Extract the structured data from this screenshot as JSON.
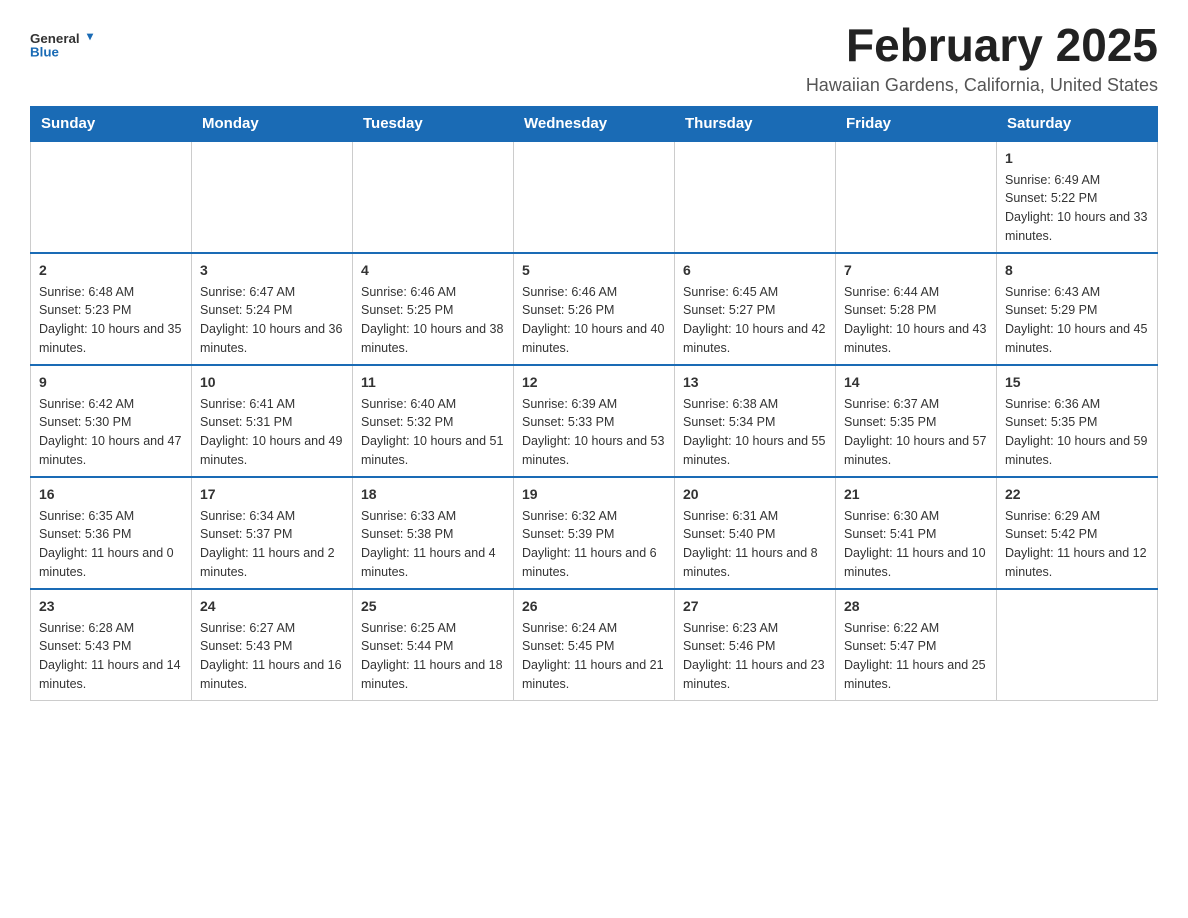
{
  "header": {
    "logo_text_general": "General",
    "logo_text_blue": "Blue",
    "month_title": "February 2025",
    "location": "Hawaiian Gardens, California, United States"
  },
  "days_of_week": [
    "Sunday",
    "Monday",
    "Tuesday",
    "Wednesday",
    "Thursday",
    "Friday",
    "Saturday"
  ],
  "weeks": [
    {
      "days": [
        {
          "num": "",
          "info": ""
        },
        {
          "num": "",
          "info": ""
        },
        {
          "num": "",
          "info": ""
        },
        {
          "num": "",
          "info": ""
        },
        {
          "num": "",
          "info": ""
        },
        {
          "num": "",
          "info": ""
        },
        {
          "num": "1",
          "info": "Sunrise: 6:49 AM\nSunset: 5:22 PM\nDaylight: 10 hours and 33 minutes."
        }
      ]
    },
    {
      "days": [
        {
          "num": "2",
          "info": "Sunrise: 6:48 AM\nSunset: 5:23 PM\nDaylight: 10 hours and 35 minutes."
        },
        {
          "num": "3",
          "info": "Sunrise: 6:47 AM\nSunset: 5:24 PM\nDaylight: 10 hours and 36 minutes."
        },
        {
          "num": "4",
          "info": "Sunrise: 6:46 AM\nSunset: 5:25 PM\nDaylight: 10 hours and 38 minutes."
        },
        {
          "num": "5",
          "info": "Sunrise: 6:46 AM\nSunset: 5:26 PM\nDaylight: 10 hours and 40 minutes."
        },
        {
          "num": "6",
          "info": "Sunrise: 6:45 AM\nSunset: 5:27 PM\nDaylight: 10 hours and 42 minutes."
        },
        {
          "num": "7",
          "info": "Sunrise: 6:44 AM\nSunset: 5:28 PM\nDaylight: 10 hours and 43 minutes."
        },
        {
          "num": "8",
          "info": "Sunrise: 6:43 AM\nSunset: 5:29 PM\nDaylight: 10 hours and 45 minutes."
        }
      ]
    },
    {
      "days": [
        {
          "num": "9",
          "info": "Sunrise: 6:42 AM\nSunset: 5:30 PM\nDaylight: 10 hours and 47 minutes."
        },
        {
          "num": "10",
          "info": "Sunrise: 6:41 AM\nSunset: 5:31 PM\nDaylight: 10 hours and 49 minutes."
        },
        {
          "num": "11",
          "info": "Sunrise: 6:40 AM\nSunset: 5:32 PM\nDaylight: 10 hours and 51 minutes."
        },
        {
          "num": "12",
          "info": "Sunrise: 6:39 AM\nSunset: 5:33 PM\nDaylight: 10 hours and 53 minutes."
        },
        {
          "num": "13",
          "info": "Sunrise: 6:38 AM\nSunset: 5:34 PM\nDaylight: 10 hours and 55 minutes."
        },
        {
          "num": "14",
          "info": "Sunrise: 6:37 AM\nSunset: 5:35 PM\nDaylight: 10 hours and 57 minutes."
        },
        {
          "num": "15",
          "info": "Sunrise: 6:36 AM\nSunset: 5:35 PM\nDaylight: 10 hours and 59 minutes."
        }
      ]
    },
    {
      "days": [
        {
          "num": "16",
          "info": "Sunrise: 6:35 AM\nSunset: 5:36 PM\nDaylight: 11 hours and 0 minutes."
        },
        {
          "num": "17",
          "info": "Sunrise: 6:34 AM\nSunset: 5:37 PM\nDaylight: 11 hours and 2 minutes."
        },
        {
          "num": "18",
          "info": "Sunrise: 6:33 AM\nSunset: 5:38 PM\nDaylight: 11 hours and 4 minutes."
        },
        {
          "num": "19",
          "info": "Sunrise: 6:32 AM\nSunset: 5:39 PM\nDaylight: 11 hours and 6 minutes."
        },
        {
          "num": "20",
          "info": "Sunrise: 6:31 AM\nSunset: 5:40 PM\nDaylight: 11 hours and 8 minutes."
        },
        {
          "num": "21",
          "info": "Sunrise: 6:30 AM\nSunset: 5:41 PM\nDaylight: 11 hours and 10 minutes."
        },
        {
          "num": "22",
          "info": "Sunrise: 6:29 AM\nSunset: 5:42 PM\nDaylight: 11 hours and 12 minutes."
        }
      ]
    },
    {
      "days": [
        {
          "num": "23",
          "info": "Sunrise: 6:28 AM\nSunset: 5:43 PM\nDaylight: 11 hours and 14 minutes."
        },
        {
          "num": "24",
          "info": "Sunrise: 6:27 AM\nSunset: 5:43 PM\nDaylight: 11 hours and 16 minutes."
        },
        {
          "num": "25",
          "info": "Sunrise: 6:25 AM\nSunset: 5:44 PM\nDaylight: 11 hours and 18 minutes."
        },
        {
          "num": "26",
          "info": "Sunrise: 6:24 AM\nSunset: 5:45 PM\nDaylight: 11 hours and 21 minutes."
        },
        {
          "num": "27",
          "info": "Sunrise: 6:23 AM\nSunset: 5:46 PM\nDaylight: 11 hours and 23 minutes."
        },
        {
          "num": "28",
          "info": "Sunrise: 6:22 AM\nSunset: 5:47 PM\nDaylight: 11 hours and 25 minutes."
        },
        {
          "num": "",
          "info": ""
        }
      ]
    }
  ]
}
